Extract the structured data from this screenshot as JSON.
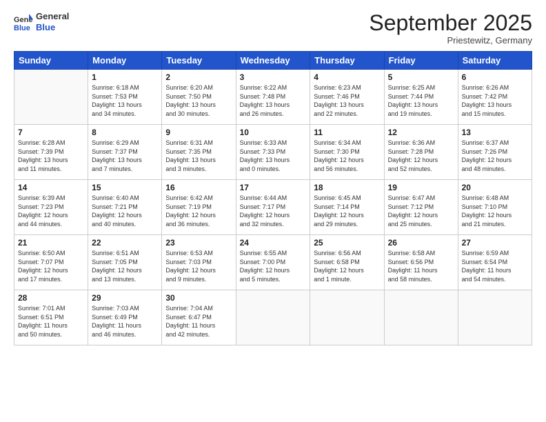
{
  "header": {
    "logo_general": "General",
    "logo_blue": "Blue",
    "month_title": "September 2025",
    "subtitle": "Priestewitz, Germany"
  },
  "weekdays": [
    "Sunday",
    "Monday",
    "Tuesday",
    "Wednesday",
    "Thursday",
    "Friday",
    "Saturday"
  ],
  "weeks": [
    [
      {
        "day": "",
        "info": ""
      },
      {
        "day": "1",
        "info": "Sunrise: 6:18 AM\nSunset: 7:53 PM\nDaylight: 13 hours\nand 34 minutes."
      },
      {
        "day": "2",
        "info": "Sunrise: 6:20 AM\nSunset: 7:50 PM\nDaylight: 13 hours\nand 30 minutes."
      },
      {
        "day": "3",
        "info": "Sunrise: 6:22 AM\nSunset: 7:48 PM\nDaylight: 13 hours\nand 26 minutes."
      },
      {
        "day": "4",
        "info": "Sunrise: 6:23 AM\nSunset: 7:46 PM\nDaylight: 13 hours\nand 22 minutes."
      },
      {
        "day": "5",
        "info": "Sunrise: 6:25 AM\nSunset: 7:44 PM\nDaylight: 13 hours\nand 19 minutes."
      },
      {
        "day": "6",
        "info": "Sunrise: 6:26 AM\nSunset: 7:42 PM\nDaylight: 13 hours\nand 15 minutes."
      }
    ],
    [
      {
        "day": "7",
        "info": "Sunrise: 6:28 AM\nSunset: 7:39 PM\nDaylight: 13 hours\nand 11 minutes."
      },
      {
        "day": "8",
        "info": "Sunrise: 6:29 AM\nSunset: 7:37 PM\nDaylight: 13 hours\nand 7 minutes."
      },
      {
        "day": "9",
        "info": "Sunrise: 6:31 AM\nSunset: 7:35 PM\nDaylight: 13 hours\nand 3 minutes."
      },
      {
        "day": "10",
        "info": "Sunrise: 6:33 AM\nSunset: 7:33 PM\nDaylight: 13 hours\nand 0 minutes."
      },
      {
        "day": "11",
        "info": "Sunrise: 6:34 AM\nSunset: 7:30 PM\nDaylight: 12 hours\nand 56 minutes."
      },
      {
        "day": "12",
        "info": "Sunrise: 6:36 AM\nSunset: 7:28 PM\nDaylight: 12 hours\nand 52 minutes."
      },
      {
        "day": "13",
        "info": "Sunrise: 6:37 AM\nSunset: 7:26 PM\nDaylight: 12 hours\nand 48 minutes."
      }
    ],
    [
      {
        "day": "14",
        "info": "Sunrise: 6:39 AM\nSunset: 7:23 PM\nDaylight: 12 hours\nand 44 minutes."
      },
      {
        "day": "15",
        "info": "Sunrise: 6:40 AM\nSunset: 7:21 PM\nDaylight: 12 hours\nand 40 minutes."
      },
      {
        "day": "16",
        "info": "Sunrise: 6:42 AM\nSunset: 7:19 PM\nDaylight: 12 hours\nand 36 minutes."
      },
      {
        "day": "17",
        "info": "Sunrise: 6:44 AM\nSunset: 7:17 PM\nDaylight: 12 hours\nand 32 minutes."
      },
      {
        "day": "18",
        "info": "Sunrise: 6:45 AM\nSunset: 7:14 PM\nDaylight: 12 hours\nand 29 minutes."
      },
      {
        "day": "19",
        "info": "Sunrise: 6:47 AM\nSunset: 7:12 PM\nDaylight: 12 hours\nand 25 minutes."
      },
      {
        "day": "20",
        "info": "Sunrise: 6:48 AM\nSunset: 7:10 PM\nDaylight: 12 hours\nand 21 minutes."
      }
    ],
    [
      {
        "day": "21",
        "info": "Sunrise: 6:50 AM\nSunset: 7:07 PM\nDaylight: 12 hours\nand 17 minutes."
      },
      {
        "day": "22",
        "info": "Sunrise: 6:51 AM\nSunset: 7:05 PM\nDaylight: 12 hours\nand 13 minutes."
      },
      {
        "day": "23",
        "info": "Sunrise: 6:53 AM\nSunset: 7:03 PM\nDaylight: 12 hours\nand 9 minutes."
      },
      {
        "day": "24",
        "info": "Sunrise: 6:55 AM\nSunset: 7:00 PM\nDaylight: 12 hours\nand 5 minutes."
      },
      {
        "day": "25",
        "info": "Sunrise: 6:56 AM\nSunset: 6:58 PM\nDaylight: 12 hours\nand 1 minute."
      },
      {
        "day": "26",
        "info": "Sunrise: 6:58 AM\nSunset: 6:56 PM\nDaylight: 11 hours\nand 58 minutes."
      },
      {
        "day": "27",
        "info": "Sunrise: 6:59 AM\nSunset: 6:54 PM\nDaylight: 11 hours\nand 54 minutes."
      }
    ],
    [
      {
        "day": "28",
        "info": "Sunrise: 7:01 AM\nSunset: 6:51 PM\nDaylight: 11 hours\nand 50 minutes."
      },
      {
        "day": "29",
        "info": "Sunrise: 7:03 AM\nSunset: 6:49 PM\nDaylight: 11 hours\nand 46 minutes."
      },
      {
        "day": "30",
        "info": "Sunrise: 7:04 AM\nSunset: 6:47 PM\nDaylight: 11 hours\nand 42 minutes."
      },
      {
        "day": "",
        "info": ""
      },
      {
        "day": "",
        "info": ""
      },
      {
        "day": "",
        "info": ""
      },
      {
        "day": "",
        "info": ""
      }
    ]
  ]
}
